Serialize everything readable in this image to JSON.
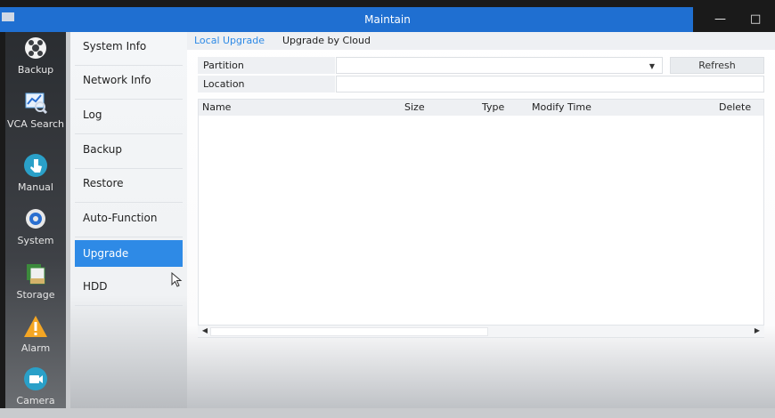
{
  "window": {
    "title": "Maintain",
    "controls": [
      "—",
      "□"
    ]
  },
  "nav": [
    {
      "label": "Backup",
      "icon": "backup-icon",
      "color": "#ffffff"
    },
    {
      "label": "VCA Search",
      "icon": "vca-search-icon",
      "color": "#5fa8e8"
    },
    {
      "label": "Manual",
      "icon": "manual-icon",
      "color": "#2aa0c8"
    },
    {
      "label": "System",
      "icon": "gear-icon",
      "color": "#2a6fd0"
    },
    {
      "label": "Storage",
      "icon": "storage-icon",
      "color": "#3c8a3c"
    },
    {
      "label": "Alarm",
      "icon": "alarm-icon",
      "color": "#f5a623"
    },
    {
      "label": "Camera",
      "icon": "camera-icon",
      "color": "#2aa0c8"
    }
  ],
  "submenu": {
    "items": [
      "System Info",
      "Network Info",
      "Log",
      "Backup",
      "Restore",
      "Auto-Function",
      "Upgrade",
      "HDD"
    ],
    "active": "Upgrade"
  },
  "tabs": [
    "Local Upgrade",
    "Upgrade by Cloud"
  ],
  "form": {
    "partition_label": "Partition",
    "partition_value": "",
    "location_label": "Location",
    "location_value": "",
    "refresh_label": "Refresh"
  },
  "table": {
    "columns": [
      "Name",
      "Size",
      "Type",
      "Modify Time",
      "Delete"
    ],
    "rows": []
  },
  "colors": {
    "accent": "#2e8ae6",
    "titlebar": "#1f6fd1"
  }
}
